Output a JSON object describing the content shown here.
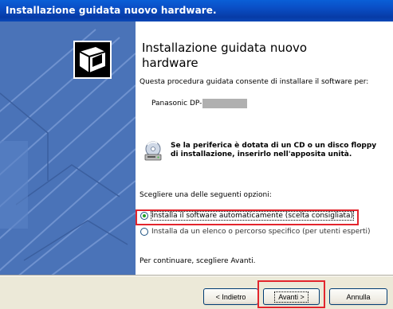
{
  "window": {
    "title": "Installazione guidata nuovo hardware."
  },
  "page": {
    "heading": "Installazione guidata nuovo hardware",
    "intro": "Questa procedura guidata consente di installare il software per:",
    "device_name": "Panasonic DP-",
    "cd_notice": "Se la periferica è dotata di un CD o un disco floppy di installazione, inserirlo nell'apposita unità.",
    "choose_prompt": "Scegliere una delle seguenti opzioni:",
    "options": [
      {
        "label": "Installa il software automaticamente (scelta consigliata)",
        "selected": true
      },
      {
        "label": "Installa da un elenco o percorso specifico (per utenti esperti)",
        "selected": false
      }
    ],
    "continue_hint": "Per continuare, scegliere Avanti."
  },
  "buttons": {
    "back": "< Indietro",
    "next": "Avanti >",
    "cancel": "Annulla"
  },
  "colors": {
    "titlebar": "#0a4fc6",
    "left_panel": "#4a73b8",
    "highlight": "#e3252d",
    "radio_dot": "#21a121"
  }
}
